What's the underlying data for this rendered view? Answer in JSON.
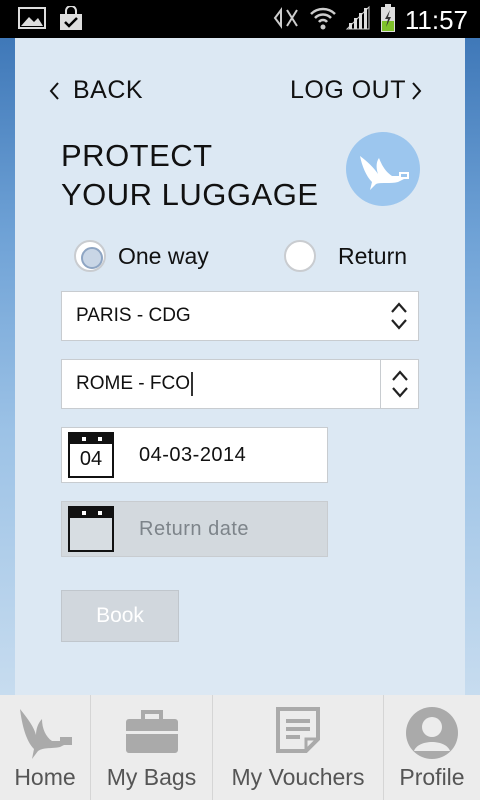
{
  "status_bar": {
    "time": "11:57"
  },
  "nav": {
    "back_label": "BACK",
    "logout_label": "LOG OUT"
  },
  "header": {
    "title_line1": "PROTECT",
    "title_line2": "YOUR LUGGAGE"
  },
  "trip_type": {
    "options": [
      {
        "label": "One way",
        "selected": true
      },
      {
        "label": "Return",
        "selected": false
      }
    ]
  },
  "origin": {
    "value": "PARIS - CDG"
  },
  "destination": {
    "value": "ROME - FCO"
  },
  "departure": {
    "calendar_day": "04",
    "value": "04-03-2014"
  },
  "return_date": {
    "placeholder": "Return date"
  },
  "book_label": "Book",
  "tabs": [
    {
      "label": "Home",
      "icon": "bird-icon"
    },
    {
      "label": "My Bags",
      "icon": "briefcase-icon"
    },
    {
      "label": "My Vouchers",
      "icon": "document-icon"
    },
    {
      "label": "Profile",
      "icon": "user-icon"
    }
  ],
  "colors": {
    "panel": "#dce8f3",
    "logo_bg": "#9cc6ee",
    "button_disabled": "#d1d7dd",
    "tabbar": "#ececec"
  }
}
